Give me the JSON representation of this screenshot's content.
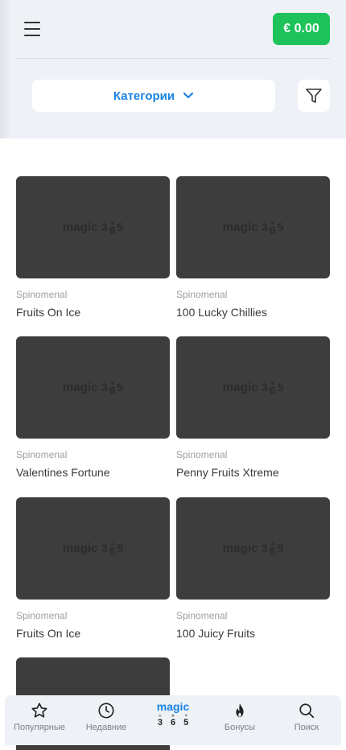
{
  "header": {
    "balance": "€ 0.00"
  },
  "filters": {
    "category_label": "Категории"
  },
  "logo": {
    "word": "magic",
    "digits": [
      "3",
      "6",
      "5"
    ]
  },
  "games": [
    {
      "provider": "Spinomenal",
      "title": "Fruits On Ice"
    },
    {
      "provider": "Spinomenal",
      "title": "100 Lucky Chillies"
    },
    {
      "provider": "Spinomenal",
      "title": "Valentines Fortune"
    },
    {
      "provider": "Spinomenal",
      "title": "Penny Fruits Xtreme"
    },
    {
      "provider": "Spinomenal",
      "title": "Fruits On Ice"
    },
    {
      "provider": "Spinomenal",
      "title": "100 Juicy Fruits"
    },
    {
      "provider": "",
      "title": ""
    }
  ],
  "bottom_nav": {
    "popular": "Популярные",
    "recent": "Недавние",
    "bonuses": "Бонусы",
    "search": "Поиск"
  },
  "colors": {
    "accent_green": "#1ec25a",
    "accent_blue": "#1a82e2",
    "thumb_bg": "#3d3d3d",
    "top_bg": "#eef2f7"
  }
}
